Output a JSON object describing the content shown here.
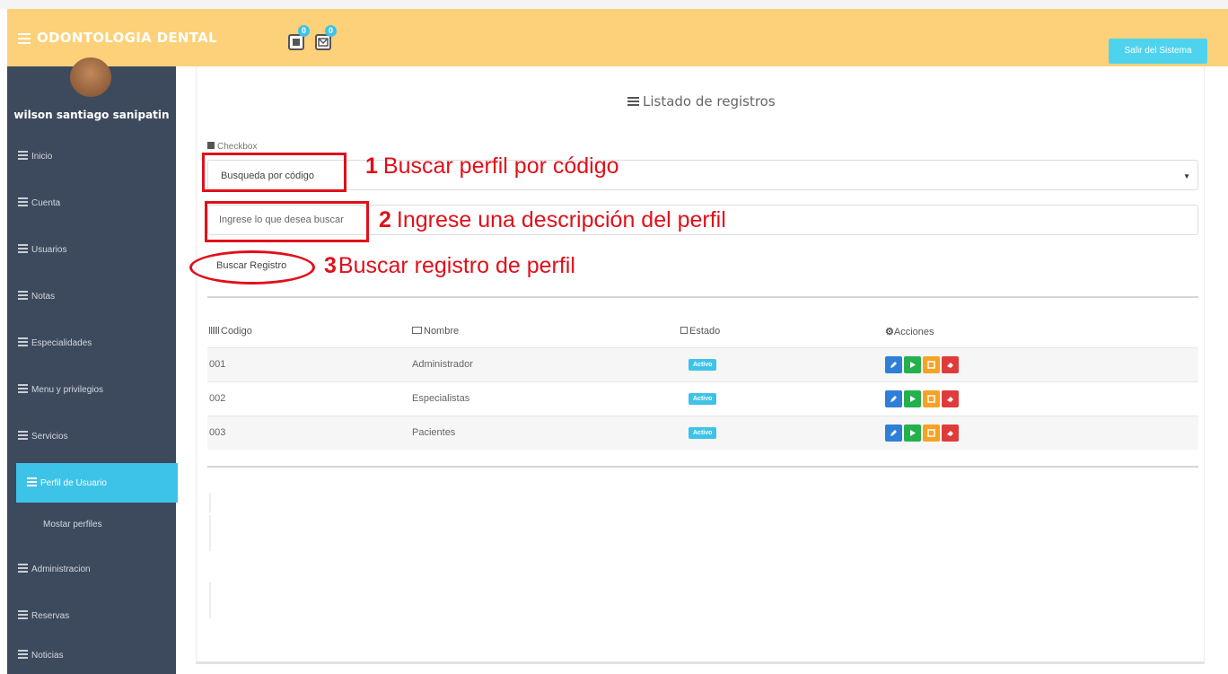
{
  "header": {
    "brand": "ODONTOLOGIA DENTAL",
    "notifications": [
      {
        "icon": "document-icon",
        "count": "0"
      },
      {
        "icon": "mail-icon",
        "count": "0"
      }
    ],
    "logout_label": "Salir del Sistema",
    "color": "#fdd179",
    "accent": "#4ed3ee"
  },
  "sidebar": {
    "user_name": "wilson santiago sanipatin",
    "items": [
      {
        "label": "Inicio"
      },
      {
        "label": "Cuenta"
      },
      {
        "label": "Usuarios"
      },
      {
        "label": "Notas"
      },
      {
        "label": "Especialidades"
      },
      {
        "label": "Menu y privilegios"
      },
      {
        "label": "Servicios"
      },
      {
        "label": "Perfil de Usuario",
        "active": true
      },
      {
        "label": "Administracion"
      },
      {
        "label": "Reservas"
      },
      {
        "label": "Noticias"
      }
    ],
    "sub_item": "Mostar perfiles"
  },
  "main": {
    "list_title": "Listado de registros",
    "checkbox_label": "Checkbox",
    "select_value": "Busqueda por código",
    "search_placeholder": "Ingrese lo que desea buscar",
    "search_button": "Buscar Registro",
    "annotations": {
      "a1_num": "1",
      "a1_text": "Buscar perfil por código",
      "a2_num": "2",
      "a2_text": "Ingrese una descripción del perfil",
      "a3_num": "3",
      "a3_text": "Buscar registro de perfil"
    },
    "table": {
      "headers": [
        "Codigo",
        "Nombre",
        "Estado",
        "Acciones"
      ],
      "rows": [
        {
          "codigo": "001",
          "nombre": "Administrador",
          "estado": "Activo"
        },
        {
          "codigo": "002",
          "nombre": "Especialistas",
          "estado": "Activo"
        },
        {
          "codigo": "003",
          "nombre": "Pacientes",
          "estado": "Activo"
        }
      ],
      "action_icons": [
        "edit-icon",
        "play-icon",
        "stop-icon",
        "erase-icon"
      ]
    }
  }
}
